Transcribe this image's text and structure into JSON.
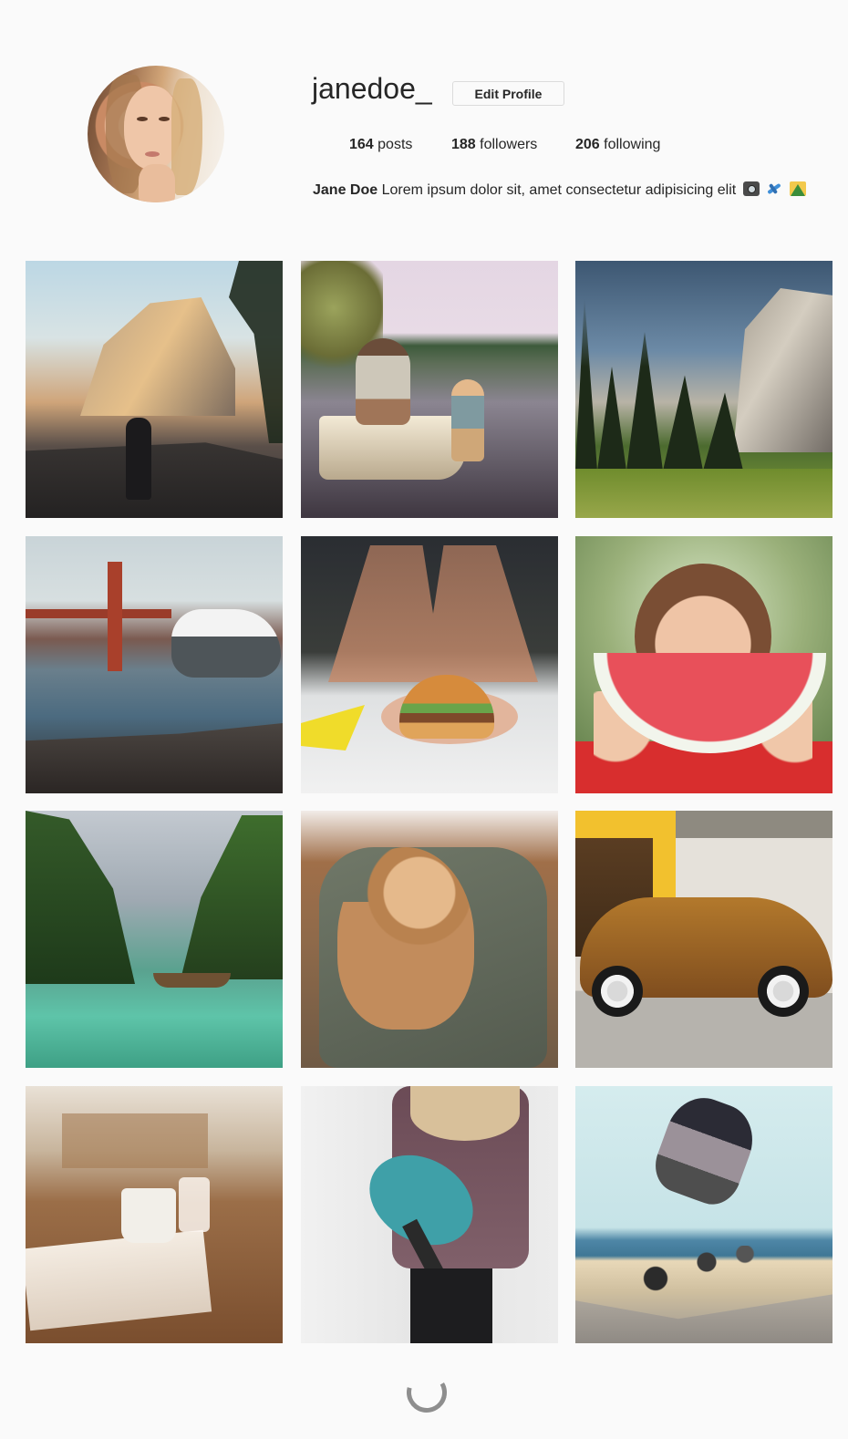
{
  "profile": {
    "username": "janedoe_",
    "edit_button_label": "Edit Profile",
    "stats": {
      "posts_count": "164",
      "posts_label": "posts",
      "followers_count": "188",
      "followers_label": "followers",
      "following_count": "206",
      "following_label": "following"
    },
    "bio": {
      "name": "Jane Doe",
      "text": "Lorem ipsum dolor sit, amet consectetur adipisicing elit",
      "emoji_icons": [
        "camera-icon",
        "airplane-icon",
        "mountain-icon"
      ]
    }
  },
  "gallery": {
    "images": [
      {
        "name": "half-dome-road-photo"
      },
      {
        "name": "lake-mother-child-photo"
      },
      {
        "name": "el-capitan-valley-photo"
      },
      {
        "name": "seagull-golden-gate-photo"
      },
      {
        "name": "burger-plate-photo"
      },
      {
        "name": "watermelon-smile-photo"
      },
      {
        "name": "tropical-islands-boat-photo"
      },
      {
        "name": "puppy-backpack-photo"
      },
      {
        "name": "vintage-beetle-car-photo"
      },
      {
        "name": "cafe-desk-mug-photo"
      },
      {
        "name": "guitar-player-photo"
      },
      {
        "name": "beach-skateboarder-photo"
      }
    ]
  },
  "loading": {
    "icon": "loading-spinner-icon"
  },
  "colors": {
    "background": "#fafafa",
    "text": "#262626",
    "button_border": "#dbdbdb",
    "spinner": "#8e8e8e"
  }
}
